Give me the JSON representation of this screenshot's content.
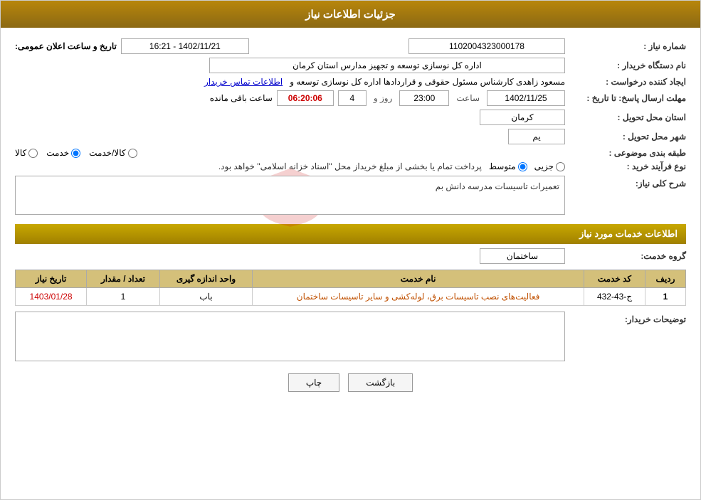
{
  "header": {
    "title": "جزئیات اطلاعات نیاز"
  },
  "fields": {
    "shomara_niaz_label": "شماره نیاز :",
    "shomara_niaz_value": "1102004323000178",
    "nam_dastgah_label": "نام دستگاه خریدار :",
    "nam_dastgah_value": "اداره کل نوسازی  توسعه و تجهیز مدارس استان کرمان",
    "ijad_konande_label": "ایجاد کننده درخواست :",
    "ijad_konande_value": "مسعود زاهدی کارشناس مسئول حقوقی و قراردادها اداره کل نوسازی  توسعه و",
    "ijad_konande_link": "اطلاعات تماس خریدار",
    "mohlet_label": "مهلت ارسال پاسخ: تا تاریخ :",
    "mohlet_date": "1402/11/25",
    "mohlet_time_label": "ساعت",
    "mohlet_time": "23:00",
    "mohlet_rooz_label": "روز و",
    "mohlet_rooz": "4",
    "mohlet_countdown": "06:20:06",
    "mohlet_remaining": "ساعت باقی مانده",
    "ostan_label": "استان محل تحویل :",
    "ostan_value": "کرمان",
    "shahr_label": "شهر محل تحویل :",
    "shahr_value": "یم",
    "tabaqe_label": "طبقه بندی موضوعی :",
    "radio_kala": "کالا",
    "radio_khedmat": "خدمت",
    "radio_kala_khedmat": "کالا/خدمت",
    "radio_selected": "khedmat",
    "nooe_farayand_label": "نوع فرآیند خرید :",
    "nooe_farayand_text": "پرداخت تمام یا بخشی از مبلغ خریداز محل \"اسناد خزانه اسلامی\" خواهد بود.",
    "radio_jazzi": "جزیی",
    "radio_motovaset": "متوسط",
    "radio_selected2": "motovaset",
    "sharh_label": "شرح کلی نیاز:",
    "sharh_value": "تعمیرات تاسیسات مدرسه دانش بم",
    "section_khadamat": "اطلاعات خدمات مورد نیاز",
    "grooh_khadamat_label": "گروه خدمت:",
    "grooh_khadamat_value": "ساختمان",
    "tarikhe_elam_label": "تاریخ و ساعت اعلان عمومی:",
    "tarikhe_elam_value": "1402/11/21 - 16:21",
    "tawzih_label": "توضیحات خریدار:",
    "service_table": {
      "headers": [
        "ردیف",
        "کد خدمت",
        "نام خدمت",
        "واحد اندازه گیری",
        "تعداد / مقدار",
        "تاریخ نیاز"
      ],
      "rows": [
        {
          "radif": "1",
          "kod": "ج-43-432",
          "name": "فعالیت‌های نصب تاسیسات برق، لوله‌کشی و سایر تاسیسات ساختمان",
          "vahed": "باب",
          "tedad": "1",
          "tarikh": "1403/01/28"
        }
      ]
    }
  },
  "buttons": {
    "print_label": "چاپ",
    "back_label": "بازگشت"
  }
}
